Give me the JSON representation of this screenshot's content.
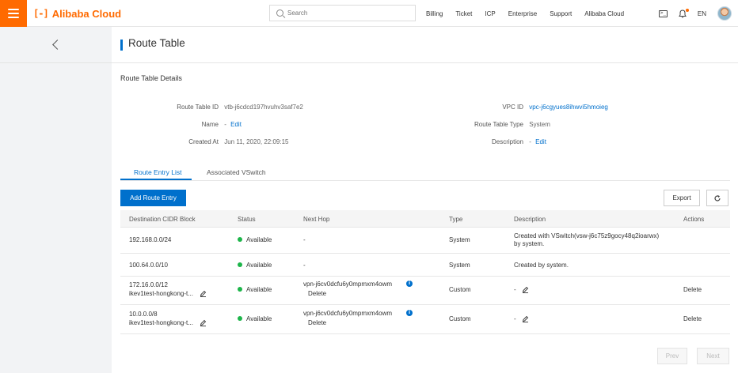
{
  "brand": {
    "logo_mark": "[-]",
    "name": "Alibaba Cloud"
  },
  "search": {
    "placeholder": "Search"
  },
  "nav": {
    "items": [
      "Billing",
      "Ticket",
      "ICP",
      "Enterprise",
      "Support",
      "Alibaba Cloud"
    ],
    "lang": "EN"
  },
  "icons": {
    "menu": "hamburger-icon",
    "back": "chevron-left-icon",
    "refresh": "refresh-icon",
    "edit": "pencil-icon",
    "info": "info-icon"
  },
  "colors": {
    "brand": "#ff6a00",
    "primary": "#0070cc",
    "available": "#1db54a"
  },
  "page": {
    "title": "Route Table",
    "section": "Route Table Details"
  },
  "details": {
    "route_table_id_label": "Route Table ID",
    "route_table_id": "vtb-j6cdcd197hvuhv3saf7e2",
    "name_label": "Name",
    "name_value": "-",
    "name_edit": "Edit",
    "created_label": "Created At",
    "created_value": "Jun 11, 2020, 22:09:15",
    "vpc_label": "VPC ID",
    "vpc_value": "vpc-j6cgyues8ihwvi5hmoieg",
    "type_label": "Route Table Type",
    "type_value": "System",
    "desc_label": "Description",
    "desc_value": "-",
    "desc_edit": "Edit"
  },
  "tabs": [
    "Route Entry List",
    "Associated VSwitch"
  ],
  "toolbar": {
    "add": "Add Route Entry",
    "export": "Export"
  },
  "table": {
    "headers": [
      "Destination CIDR Block",
      "Status",
      "Next Hop",
      "Type",
      "Description",
      "Actions"
    ],
    "rows": [
      {
        "cidr": "192.168.0.0/24",
        "cidr_sub": "",
        "status": "Available",
        "next_hop": "-",
        "next_hop_action": "",
        "type": "System",
        "desc_1": "Created with VSwitch(vsw-j6c75z9gocy48q2ioarwx)",
        "desc_2": "by system.",
        "action": ""
      },
      {
        "cidr": "100.64.0.0/10",
        "cidr_sub": "",
        "status": "Available",
        "next_hop": "-",
        "next_hop_action": "",
        "type": "System",
        "desc_1": "Created by system.",
        "desc_2": "",
        "action": ""
      },
      {
        "cidr": "172.16.0.0/12",
        "cidr_sub": "ikev1test-hongkong-t...",
        "status": "Available",
        "next_hop": "vpn-j6cv0dcfu6y0mpmxm4owm",
        "next_hop_action": "Delete",
        "type": "Custom",
        "desc_1": "-",
        "desc_2": "",
        "action": "Delete"
      },
      {
        "cidr": "10.0.0.0/8",
        "cidr_sub": "ikev1test-hongkong-t...",
        "status": "Available",
        "next_hop": "vpn-j6cv0dcfu6y0mpmxm4owm",
        "next_hop_action": "Delete",
        "type": "Custom",
        "desc_1": "-",
        "desc_2": "",
        "action": "Delete"
      }
    ]
  },
  "pager": {
    "prev": "Prev",
    "next": "Next"
  }
}
